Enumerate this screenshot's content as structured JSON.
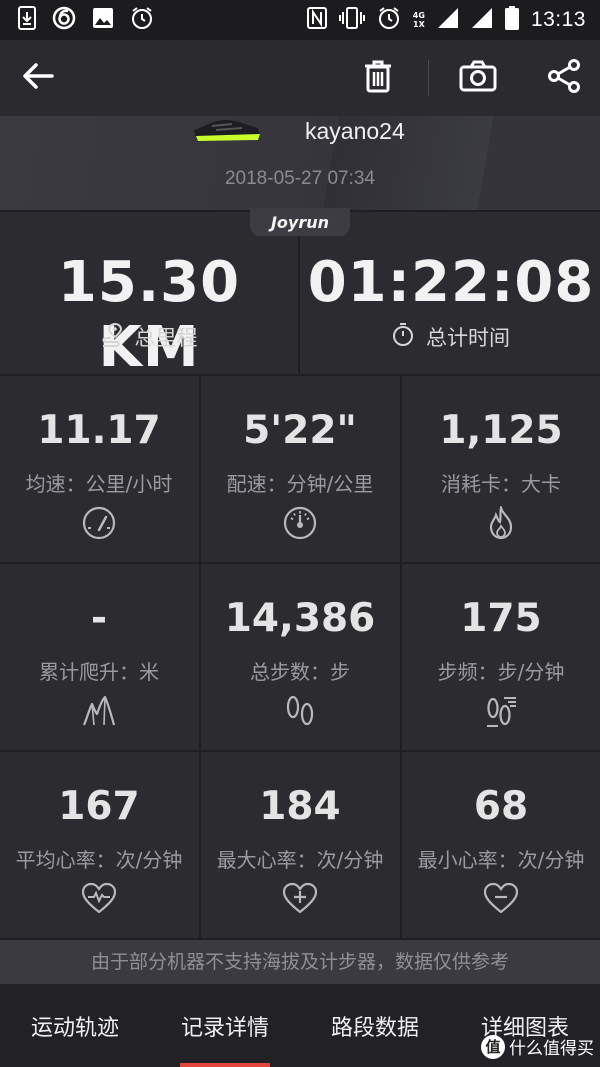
{
  "status_bar": {
    "time": "13:13",
    "network_top": "4G",
    "network_bottom": "1X",
    "icons_left": [
      "download-icon",
      "app-notification-icon",
      "image-icon",
      "alarm-icon"
    ],
    "icons_right": [
      "nfc-icon",
      "vibrate-icon",
      "alarm-icon",
      "signal-icon",
      "signal-icon",
      "battery-icon"
    ]
  },
  "toolbar": {
    "icons": [
      "back-arrow-icon",
      "trash-icon",
      "camera-icon",
      "share-icon"
    ]
  },
  "header": {
    "shoe_name": "kayano24",
    "run_datetime": "2018-05-27 07:34",
    "brand": "Joyrun"
  },
  "summary": {
    "distance_value": "15.30 KM",
    "distance_label": "总里程",
    "time_value": "01:22:08",
    "time_label": "总计时间"
  },
  "stats": [
    {
      "value": "11.17",
      "label": "均速：公里/小时",
      "icon": "speedometer-icon"
    },
    {
      "value": "5'22\"",
      "label": "配速：分钟/公里",
      "icon": "pace-gauge-icon"
    },
    {
      "value": "1,125",
      "label": "消耗卡：大卡",
      "icon": "flame-icon"
    },
    {
      "value": "-",
      "label": "累计爬升：米",
      "icon": "mountain-icon"
    },
    {
      "value": "14,386",
      "label": "总步数：步",
      "icon": "footprint-icon"
    },
    {
      "value": "175",
      "label": "步频：步/分钟",
      "icon": "step-frequency-icon"
    },
    {
      "value": "167",
      "label": "平均心率：次/分钟",
      "icon": "heart-pulse-icon"
    },
    {
      "value": "184",
      "label": "最大心率：次/分钟",
      "icon": "heart-plus-icon"
    },
    {
      "value": "68",
      "label": "最小心率：次/分钟",
      "icon": "heart-minus-icon"
    }
  ],
  "footnote": "由于部分机器不支持海拔及计步器，数据仅供参考",
  "tabs": [
    {
      "label": "运动轨迹",
      "active": false
    },
    {
      "label": "记录详情",
      "active": true
    },
    {
      "label": "路段数据",
      "active": false
    },
    {
      "label": "详细图表",
      "active": false
    }
  ],
  "watermark": {
    "badge": "值",
    "text": "什么值得买"
  },
  "colors": {
    "accent": "#e2453c",
    "background": "#2b2b30",
    "shoe_highlight": "#c8ff2a"
  }
}
